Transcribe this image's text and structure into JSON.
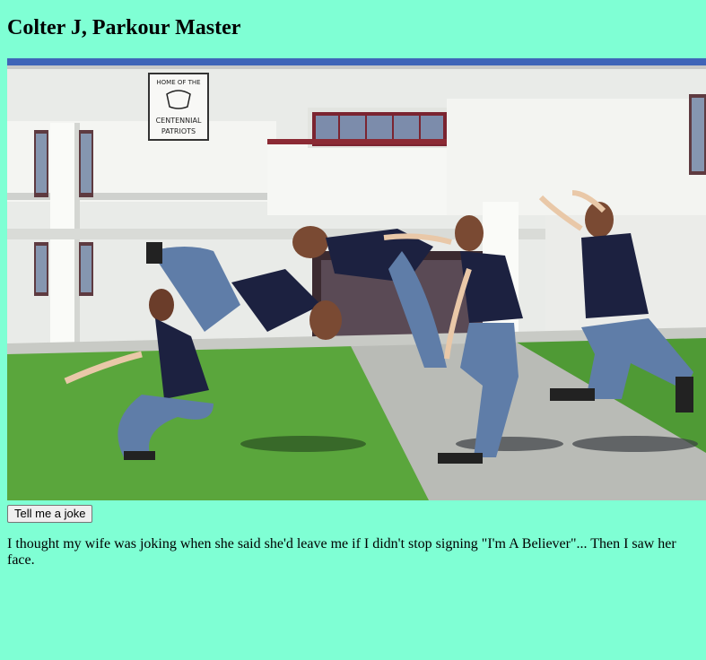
{
  "page": {
    "title": "Colter J, Parkour Master",
    "background_color": "#7fffd4"
  },
  "photo": {
    "sign_lines": [
      "HOME OF THE",
      "CENTENNIAL",
      "PATRIOTS"
    ]
  },
  "joke_button": {
    "label": "Tell me a joke"
  },
  "joke": {
    "text": "I thought my wife was joking when she said she'd leave me if I didn't stop signing \"I'm A Believer\"... Then I saw her face."
  }
}
